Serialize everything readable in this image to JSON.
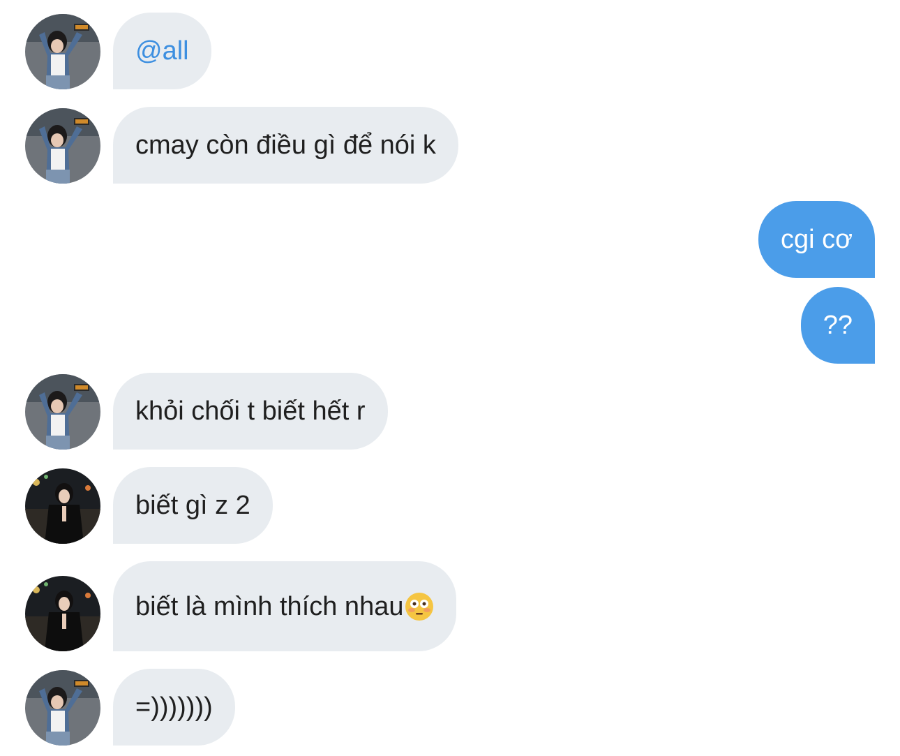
{
  "colors": {
    "incoming_bubble": "#e8ecf0",
    "outgoing_bubble": "#4b9de9",
    "mention": "#3d8fe0",
    "text": "#1f1f1f"
  },
  "messages": [
    {
      "direction": "incoming",
      "avatar": "avatar-denim-jacket",
      "text": "@all",
      "mention": true
    },
    {
      "direction": "incoming",
      "avatar": "avatar-denim-jacket",
      "text": "cmay còn điều gì để nói k"
    },
    {
      "direction": "outgoing",
      "text": "cgi cơ"
    },
    {
      "direction": "outgoing",
      "text": "??"
    },
    {
      "direction": "incoming",
      "avatar": "avatar-denim-jacket",
      "text": "khỏi chối t biết hết r"
    },
    {
      "direction": "incoming",
      "avatar": "avatar-black-dress",
      "text": "biết gì z 2"
    },
    {
      "direction": "incoming",
      "avatar": "avatar-black-dress",
      "text": "biết là mình thích nhau",
      "emoji": "flushed-face-emoji"
    },
    {
      "direction": "incoming",
      "avatar": "avatar-denim-jacket",
      "text": "=)))))))"
    }
  ]
}
